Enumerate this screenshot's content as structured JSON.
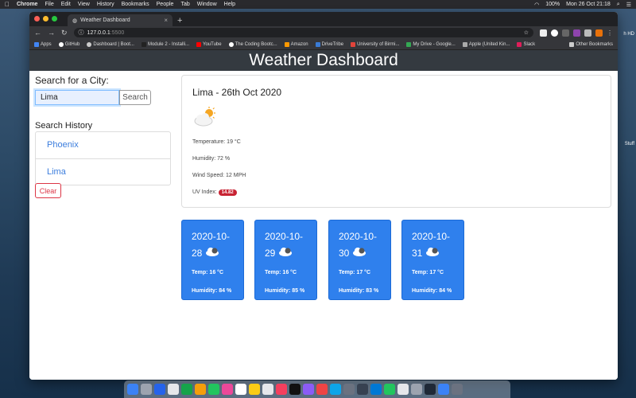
{
  "menubar": {
    "apple": "",
    "app": "Chrome",
    "items": [
      "File",
      "Edit",
      "View",
      "History",
      "Bookmarks",
      "People",
      "Tab",
      "Window",
      "Help"
    ],
    "battery": "100%",
    "clock": "Mon 26 Oct  21:18"
  },
  "desktop": {
    "labels": [
      "h HD",
      "Stuff"
    ]
  },
  "browser": {
    "tab_title": "Weather Dashboard",
    "tab_close": "×",
    "new_tab": "+",
    "url_host": "127.0.0.1",
    "url_port": ":5500",
    "bookmarks": [
      "Apps",
      "GitHub",
      "Dashboard | Boot...",
      "Module 2 - Installi...",
      "YouTube",
      "The Coding Bootc...",
      "Amazon",
      "DriveTribe",
      "University of Birmi...",
      "My Drive - Google...",
      "Apple (United Kin...",
      "Slack"
    ],
    "other_bookmarks": "Other Bookmarks"
  },
  "header": {
    "title": "Weather Dashboard"
  },
  "search": {
    "label": "Search for a City:",
    "value": "Lima",
    "button": "Search"
  },
  "history": {
    "label": "Search History",
    "items": [
      "Phoenix",
      "Lima"
    ],
    "clear": "Clear"
  },
  "current": {
    "title": "Lima - 26th Oct 2020",
    "icon": "partly-cloudy-sun-icon",
    "temperature": "Temperature: 19 °C",
    "humidity": "Humidity: 72 %",
    "wind": "Wind Speed: 12 MPH",
    "uv_label": "UV Index: ",
    "uv_value": "14.82"
  },
  "forecast": [
    {
      "date": "2020-10-28",
      "temp": "Temp: 16 °C",
      "humidity": "Humidity: 84 %"
    },
    {
      "date": "2020-10-29",
      "temp": "Temp: 16 °C",
      "humidity": "Humidity: 85 %"
    },
    {
      "date": "2020-10-30",
      "temp": "Temp: 17 °C",
      "humidity": "Humidity: 83 %"
    },
    {
      "date": "2020-10-31",
      "temp": "Temp: 17 °C",
      "humidity": "Humidity: 84 %"
    }
  ],
  "colors": {
    "header_bg": "#343a40",
    "forecast_bg": "#2f80ed",
    "link": "#3b7ddd",
    "danger": "#dc3545"
  }
}
